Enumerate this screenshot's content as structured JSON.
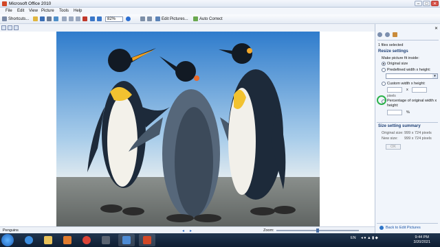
{
  "window": {
    "title": "Microsoft Office 2010",
    "controls": [
      "–",
      "□",
      "✕"
    ]
  },
  "menu": [
    "File",
    "Edit",
    "View",
    "Picture",
    "Tools",
    "Help"
  ],
  "toolbar": {
    "shortcuts": "Shortcuts...",
    "zoom": "82%",
    "edit_pictures": "Edit Pictures...",
    "auto_correct": "Auto Correct"
  },
  "status": {
    "filename": "Penguins",
    "zoom_label": "Zoom:",
    "zoom_fraction": 0.5
  },
  "panel": {
    "files_selected": "1 files selected",
    "resize_title": "Resize settings",
    "fit_inside": "Make picture fit inside:",
    "original_size": "Original size",
    "predefined": "Predefined width x height:",
    "custom": "Custom width x height:",
    "times": "x",
    "pixels": "pixels",
    "percentage": "Percentage of original width x height:",
    "percent_sign": "%",
    "summary_title": "Size setting summary",
    "original_label": "Original size:",
    "original_value": "999 x 724 pixels",
    "new_label": "New size:",
    "new_value": "999 x 724 pixels",
    "ok": "OK",
    "back_link": "Back to Edit Pictures"
  },
  "taskbar": {
    "lang": "EN",
    "time": "9:44 PM",
    "date": "3/20/2021"
  },
  "colors": {
    "title_bg": "#dfe7f3",
    "panel_bg": "#f1f5fb",
    "accent": "#1d3f75",
    "taskbar": "#16283f"
  }
}
